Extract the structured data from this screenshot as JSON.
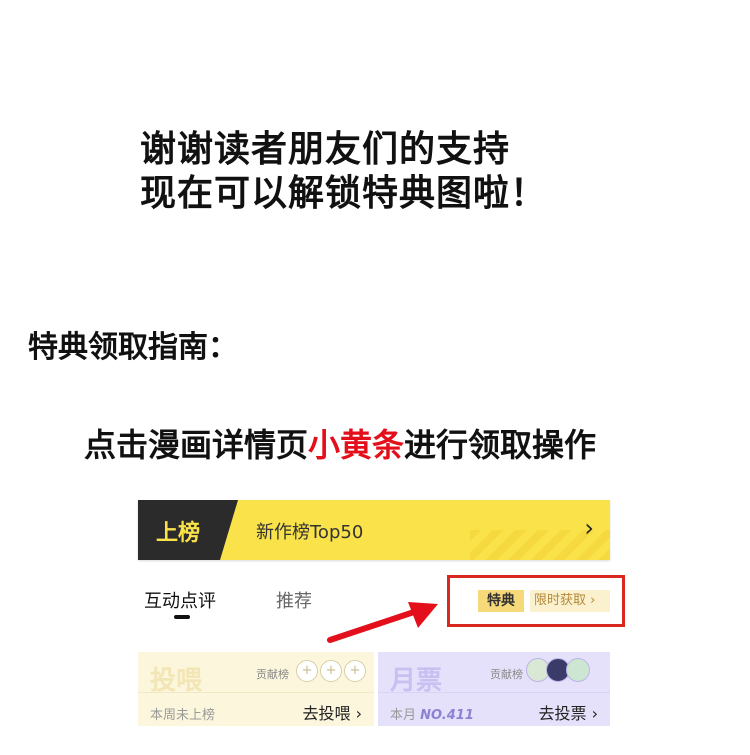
{
  "headline": {
    "line1": "谢谢读者朋友们的支持",
    "line2": "现在可以解锁特典图啦！"
  },
  "guide_title": "特典领取指南：",
  "instruction": {
    "before": "点击漫画详情页",
    "highlight": "小黄条",
    "after": "进行领取操作"
  },
  "banner": {
    "badge": "上榜",
    "label": "新作榜Top50",
    "chevron": "›"
  },
  "tabs": [
    {
      "label": "互动点评"
    },
    {
      "label": "推荐"
    }
  ],
  "special": {
    "tag": "特典",
    "text": "限时获取 ›"
  },
  "feed_card": {
    "title": "投喂",
    "contrib": "贡献榜",
    "note": "本周未上榜",
    "action": "去投喂 ›",
    "plus": [
      "+",
      "+",
      "+"
    ]
  },
  "vote_card": {
    "title": "月票",
    "contrib": "贡献榜",
    "note_prefix": "本月 ",
    "rank": "NO.411",
    "action": "去投票 ›"
  },
  "colors": {
    "highlight_red": "#e3101b",
    "banner_yellow": "#f9e24a",
    "box_red": "#d9281f"
  }
}
